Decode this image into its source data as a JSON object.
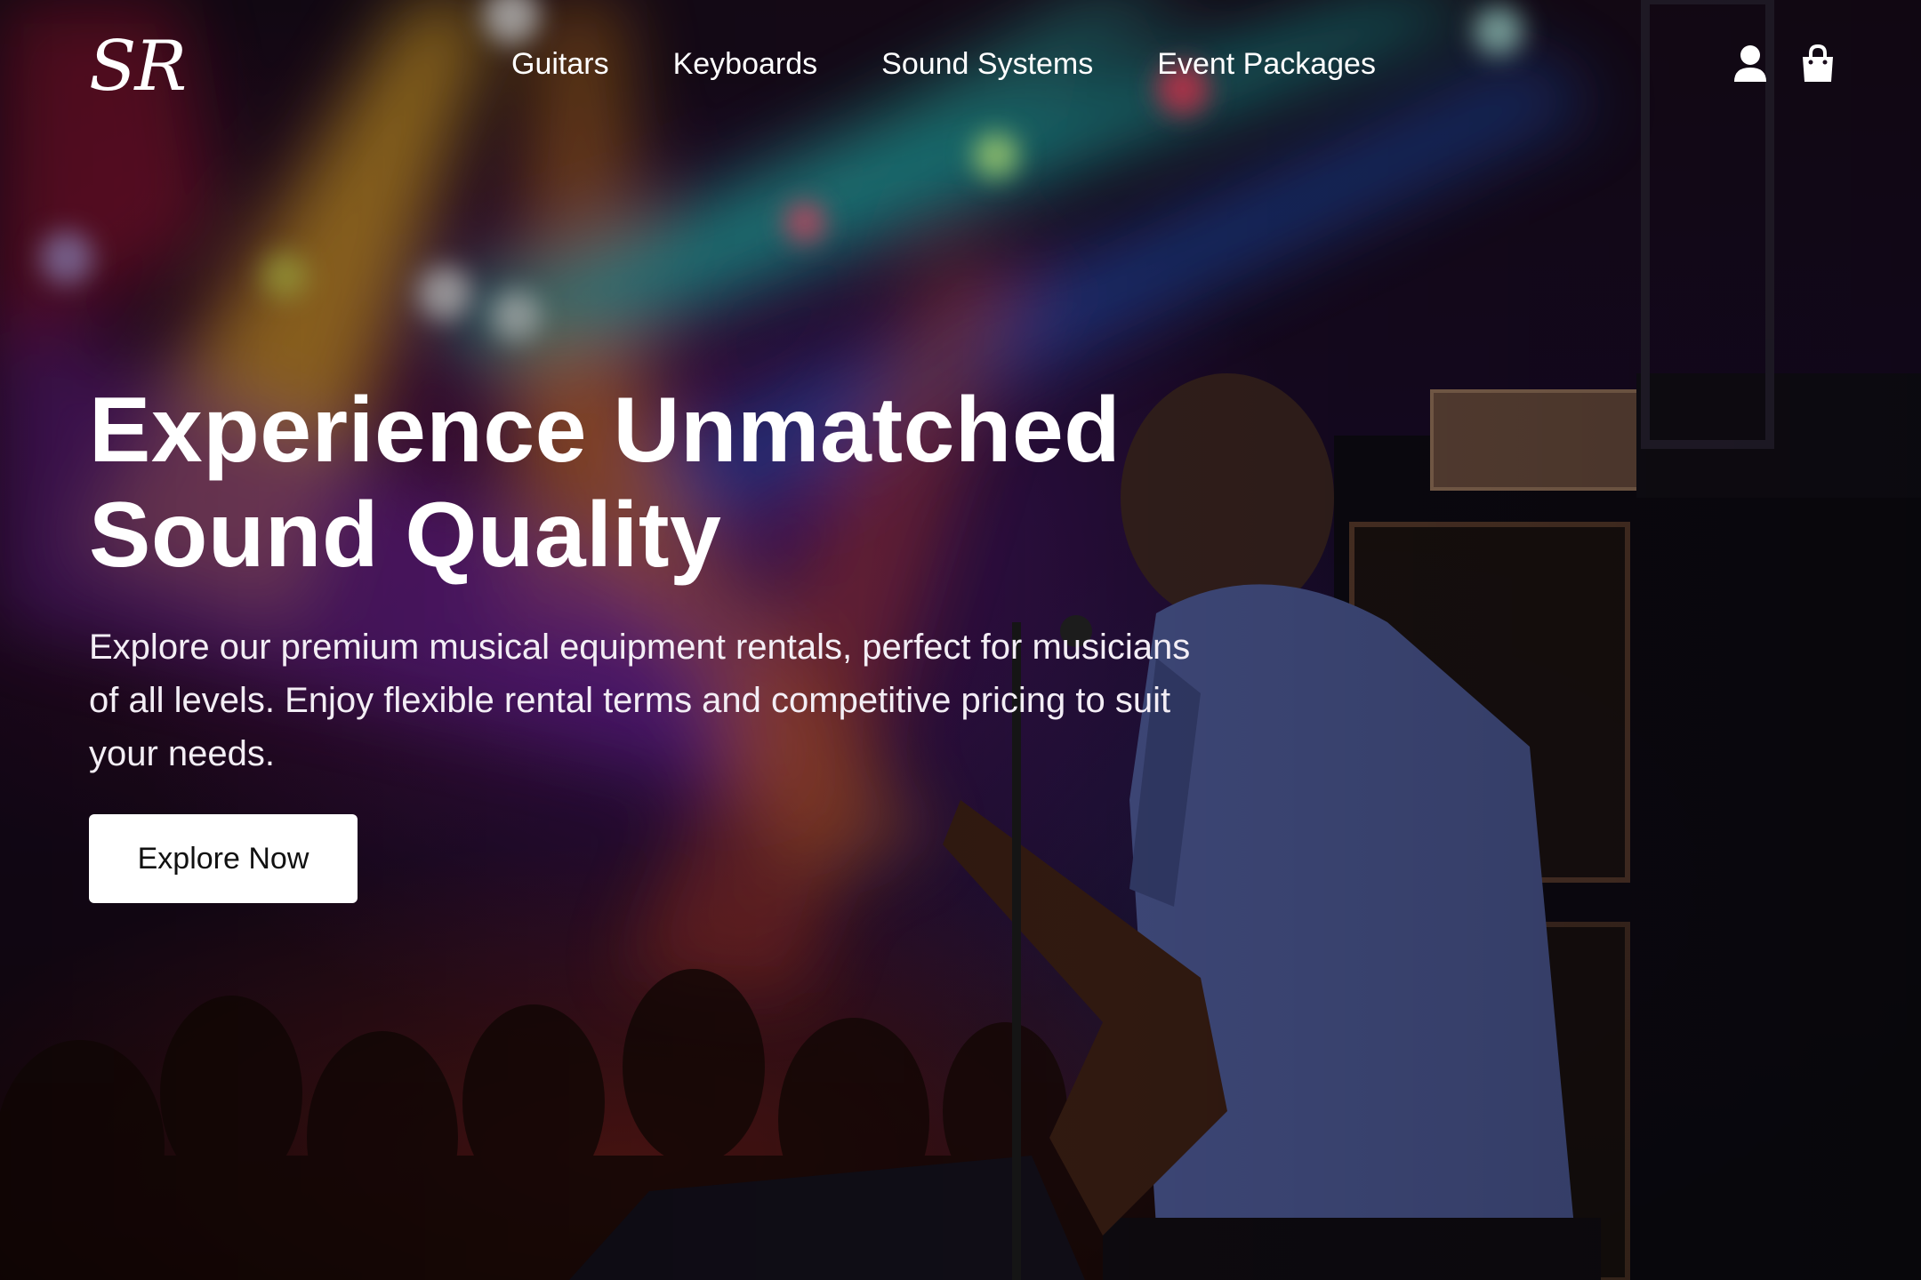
{
  "brand": {
    "logo_text": "SR"
  },
  "nav": {
    "links": [
      {
        "label": "Guitars"
      },
      {
        "label": "Keyboards"
      },
      {
        "label": "Sound Systems"
      },
      {
        "label": "Event Packages"
      }
    ],
    "icons": {
      "account": "user-icon",
      "cart": "shopping-bag-icon"
    }
  },
  "hero": {
    "title_line1": "Experience Unmatched",
    "title_line2": "Sound Quality",
    "subtitle": "Explore our premium musical equipment rentals, perfect for musicians of all levels. Enjoy flexible rental terms and competitive pricing to suit your needs.",
    "cta_label": "Explore Now",
    "background_image": "concert-stage-guitarist-photo"
  },
  "colors": {
    "text": "#ffffff",
    "button_bg": "#ffffff",
    "button_text": "#111111"
  }
}
